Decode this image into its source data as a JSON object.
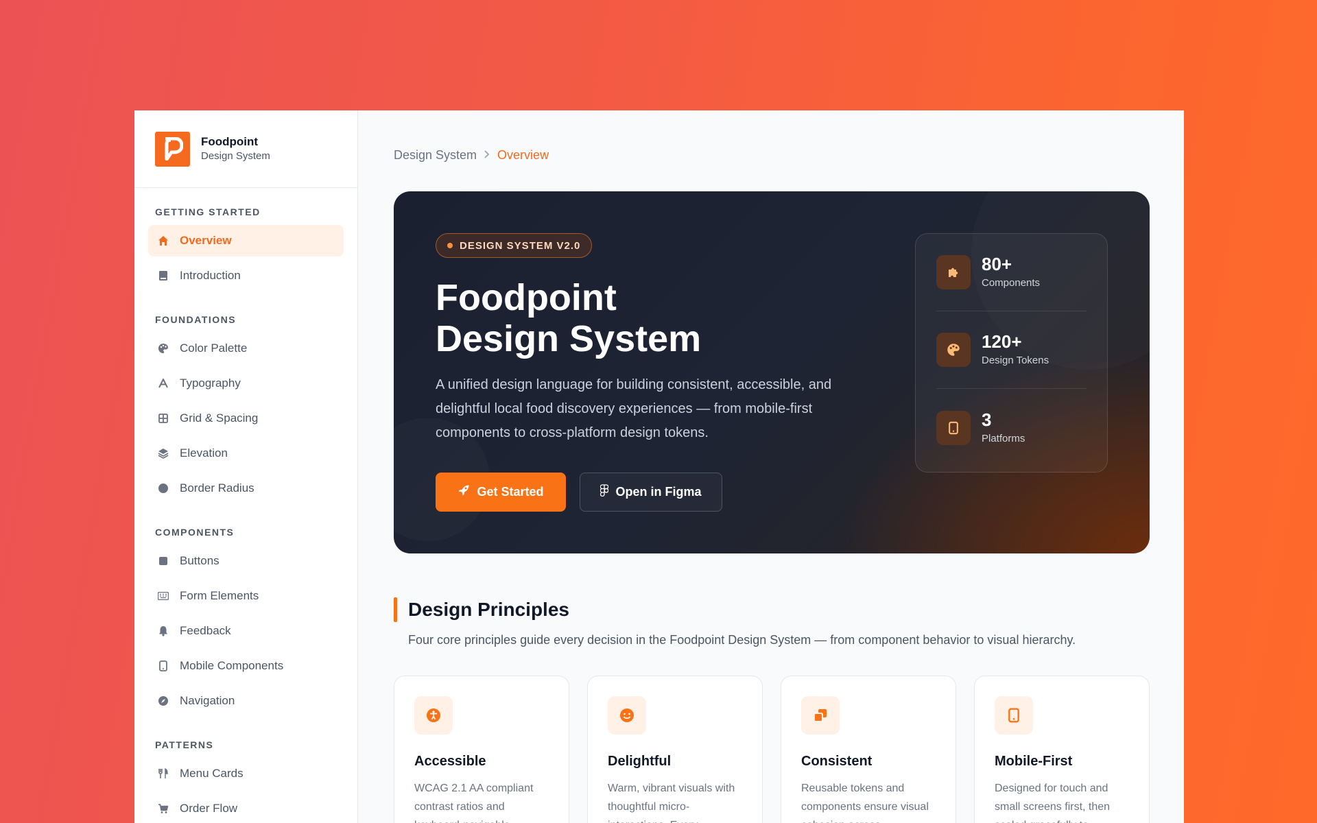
{
  "brand": {
    "name": "Foodpoint",
    "subtitle": "Design System"
  },
  "sidebar": {
    "sections": [
      {
        "heading": "GETTING STARTED",
        "items": [
          {
            "label": "Overview",
            "icon": "home-icon",
            "active": true
          },
          {
            "label": "Introduction",
            "icon": "book-icon"
          }
        ]
      },
      {
        "heading": "FOUNDATIONS",
        "items": [
          {
            "label": "Color Palette",
            "icon": "palette-icon"
          },
          {
            "label": "Typography",
            "icon": "font-icon"
          },
          {
            "label": "Grid & Spacing",
            "icon": "grid-icon"
          },
          {
            "label": "Elevation",
            "icon": "layers-icon"
          },
          {
            "label": "Border Radius",
            "icon": "circle-icon"
          }
        ]
      },
      {
        "heading": "COMPONENTS",
        "items": [
          {
            "label": "Buttons",
            "icon": "square-icon"
          },
          {
            "label": "Form Elements",
            "icon": "keyboard-icon"
          },
          {
            "label": "Feedback",
            "icon": "bell-icon"
          },
          {
            "label": "Mobile Components",
            "icon": "mobile-icon"
          },
          {
            "label": "Navigation",
            "icon": "compass-icon"
          }
        ]
      },
      {
        "heading": "PATTERNS",
        "items": [
          {
            "label": "Menu Cards",
            "icon": "utensils-icon"
          },
          {
            "label": "Order Flow",
            "icon": "cart-icon"
          }
        ]
      }
    ]
  },
  "breadcrumb": {
    "root": "Design System",
    "separator": ">",
    "current": "Overview"
  },
  "hero": {
    "badge": "DESIGN SYSTEM V2.0",
    "title_line1": "Foodpoint",
    "title_line2": "Design System",
    "description": "A unified design language for building consistent, accessible, and delightful local food discovery experiences — from mobile-first components to cross-platform design tokens.",
    "primary_button": "Get Started",
    "secondary_button": "Open in Figma",
    "stats": [
      {
        "value": "80+",
        "label": "Components",
        "icon": "puzzle-icon"
      },
      {
        "value": "120+",
        "label": "Design Tokens",
        "icon": "palette-icon"
      },
      {
        "value": "3",
        "label": "Platforms",
        "icon": "tablet-icon"
      }
    ]
  },
  "principles": {
    "title": "Design Principles",
    "description": "Four core principles guide every decision in the Foodpoint Design System — from component behavior to visual hierarchy.",
    "cards": [
      {
        "title": "Accessible",
        "desc": "WCAG 2.1 AA compliant contrast ratios and keyboard-navigable",
        "icon": "accessibility-icon"
      },
      {
        "title": "Delightful",
        "desc": "Warm, vibrant visuals with thoughtful micro-interactions. Every",
        "icon": "smile-icon"
      },
      {
        "title": "Consistent",
        "desc": "Reusable tokens and components ensure visual cohesion across",
        "icon": "clone-icon"
      },
      {
        "title": "Mobile-First",
        "desc": "Designed for touch and small screens first, then scaled gracefully to",
        "icon": "mobile-icon"
      }
    ]
  },
  "colors": {
    "accent": "#f97316",
    "hero_bg": "#1e2433",
    "page_bg": "#f8fafc"
  }
}
